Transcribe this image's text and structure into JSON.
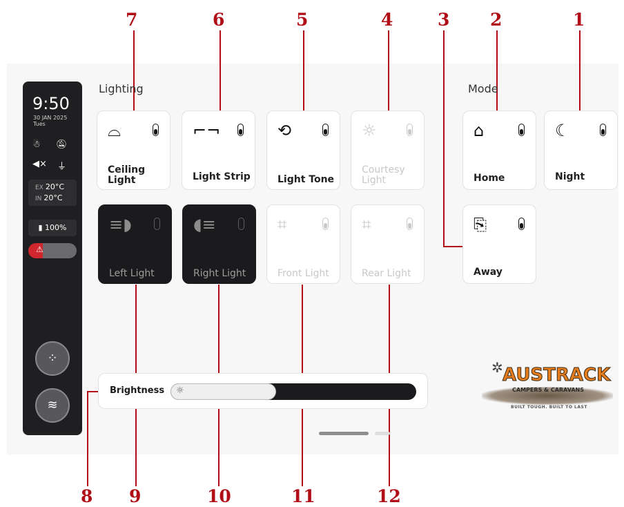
{
  "callouts": [
    "1",
    "2",
    "3",
    "4",
    "5",
    "6",
    "7",
    "8",
    "9",
    "10",
    "11",
    "12"
  ],
  "sidebar": {
    "time": "9:50",
    "date": "30 JAN 2025",
    "day": "Tues",
    "ext_label": "EX",
    "ext_temp": "20°C",
    "int_label": "IN",
    "int_temp": "20°C",
    "battery": "100%"
  },
  "lighting": {
    "title": "Lighting",
    "tiles": [
      {
        "label": "Ceiling Light",
        "state": "active"
      },
      {
        "label": "Light Strip",
        "state": "active"
      },
      {
        "label": "Light Tone",
        "state": "active"
      },
      {
        "label": "Courtesy Light",
        "state": "disabled"
      },
      {
        "label": "Left Light",
        "state": "dark"
      },
      {
        "label": "Right Light",
        "state": "dark"
      },
      {
        "label": "Front Light",
        "state": "disabled"
      },
      {
        "label": "Rear Light",
        "state": "disabled"
      }
    ]
  },
  "mode": {
    "title": "Mode",
    "tiles": [
      {
        "label": "Home"
      },
      {
        "label": "Night"
      },
      {
        "label": "Away"
      }
    ]
  },
  "brightness": {
    "label": "Brightness",
    "level": 0.43
  },
  "logo": {
    "brand": "AUSTRACK",
    "sub": "CAMPERS & CARAVANS",
    "tag": "BUILT TOUGH. BUILT TO LAST"
  },
  "colors": {
    "accent": "#b00d16",
    "dark_tile": "#1b1b1d",
    "sidebar": "#1f1f21",
    "alert": "#d0262e",
    "logo_orange": "#e57d1e"
  }
}
